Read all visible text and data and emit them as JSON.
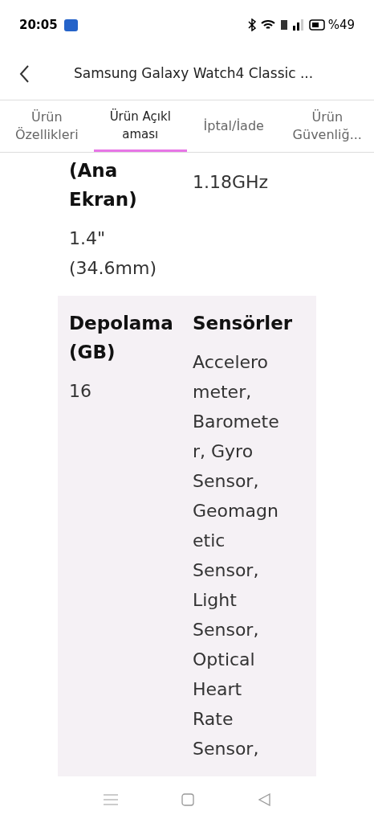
{
  "status_bar": {
    "time": "20:05",
    "battery": "%49"
  },
  "header": {
    "title": "Samsung Galaxy Watch4 Classic ..."
  },
  "tabs": [
    {
      "label": "Ürün Özellikleri",
      "selected": false
    },
    {
      "label": "Ürün Açıkl aması",
      "selected": true
    },
    {
      "label": "İptal/İade",
      "selected": false
    },
    {
      "label": "Ürün Güvenliğ...",
      "selected": false
    }
  ],
  "spec_rows": [
    {
      "shaded": false,
      "cells": [
        {
          "heading": "(Ana Ekran)",
          "text": "1.4\" (34.6mm)"
        },
        {
          "text": "1.18GHz"
        }
      ]
    },
    {
      "shaded": true,
      "cells": [
        {
          "heading": "Depolama (GB)",
          "text": "16"
        },
        {
          "heading": "Sensörler",
          "text": "Accelerometer, Barometer, Gyro Sensor, Geomagnetic Sensor, Light Sensor, Optical Heart Rate Sensor,"
        }
      ]
    }
  ]
}
